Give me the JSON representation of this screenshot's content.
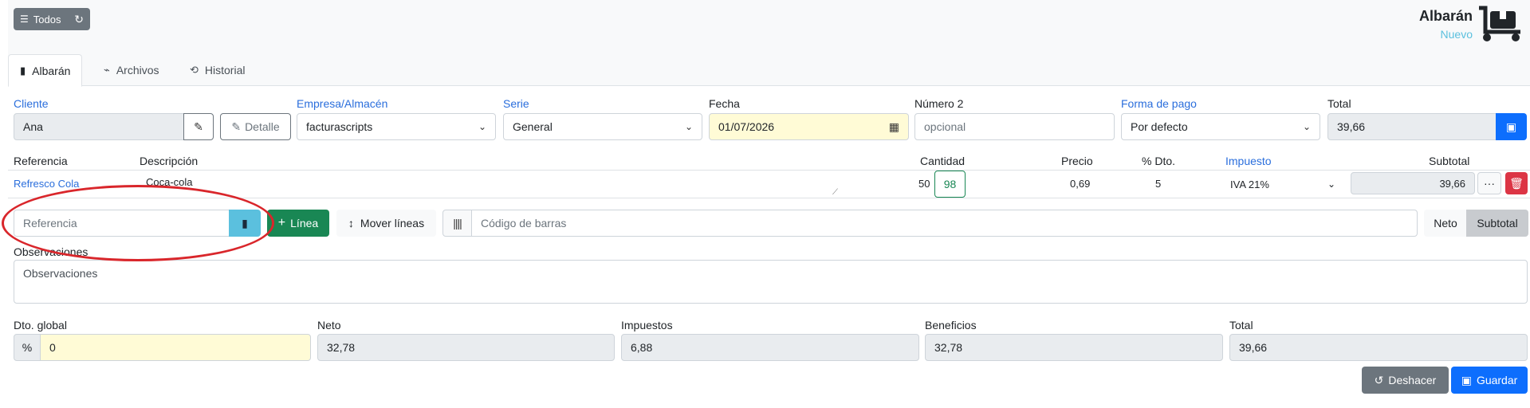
{
  "header": {
    "todos_label": "Todos",
    "doc_type": "Albarán",
    "doc_status": "Nuevo"
  },
  "tabs": [
    {
      "label": "Albarán",
      "icon": "file-icon"
    },
    {
      "label": "Archivos",
      "icon": "paperclip-icon"
    },
    {
      "label": "Historial",
      "icon": "history-icon"
    }
  ],
  "form": {
    "cliente_label": "Cliente",
    "cliente_value": "Ana",
    "detalle_label": "Detalle",
    "empresa_label": "Empresa/Almacén",
    "empresa_value": "facturascripts",
    "serie_label": "Serie",
    "serie_value": "General",
    "fecha_label": "Fecha",
    "fecha_value": "01/07/2026",
    "numero2_label": "Número 2",
    "numero2_placeholder": "opcional",
    "formapago_label": "Forma de pago",
    "formapago_value": "Por defecto",
    "total_label": "Total",
    "total_value": "39,66"
  },
  "lines": {
    "headers": {
      "referencia": "Referencia",
      "descripcion": "Descripción",
      "cantidad": "Cantidad",
      "precio": "Precio",
      "dto": "% Dto.",
      "impuesto": "Impuesto",
      "subtotal": "Subtotal"
    },
    "rows": [
      {
        "referencia": "Refresco Cola",
        "descripcion": "Coca-cola",
        "stock": "50",
        "cantidad": "98",
        "precio": "0,69",
        "dto": "5",
        "impuesto": "IVA 21%",
        "subtotal": "39,66"
      }
    ]
  },
  "toolbar": {
    "referencia_placeholder": "Referencia",
    "linea_label": "Línea",
    "mover_label": "Mover líneas",
    "barcode_placeholder": "Código de barras",
    "neto_label": "Neto",
    "subtotal_label": "Subtotal"
  },
  "observaciones": {
    "label": "Observaciones",
    "placeholder": "Observaciones"
  },
  "totals": {
    "dto_label": "Dto. global",
    "dto_value": "0",
    "neto_label": "Neto",
    "neto_value": "32,78",
    "impuestos_label": "Impuestos",
    "impuestos_value": "6,88",
    "beneficios_label": "Beneficios",
    "beneficios_value": "32,78",
    "total_label": "Total",
    "total_value": "39,66"
  },
  "actions": {
    "deshacer_label": "Deshacer",
    "guardar_label": "Guardar"
  },
  "colors": {
    "primary": "#0d6efd",
    "success": "#198754",
    "danger": "#dc3545",
    "info": "#5bc0de",
    "highlight_yellow": "#fffbd6",
    "annotation_red": "#d9262b"
  }
}
